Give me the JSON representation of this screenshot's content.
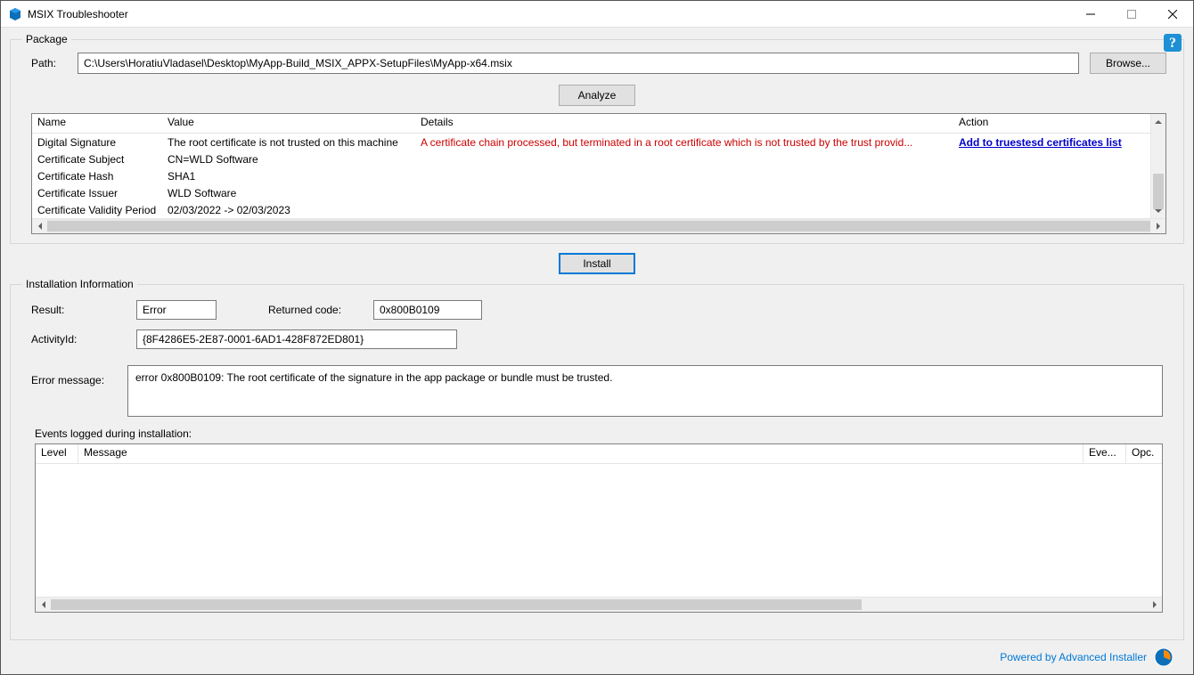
{
  "window": {
    "title": "MSIX Troubleshooter",
    "controls": {
      "minimize": "Minimize",
      "maximize": "Maximize",
      "close": "Close"
    }
  },
  "package": {
    "legend": "Package",
    "path_label": "Path:",
    "path_value": "C:\\Users\\HoratiuVladasel\\Desktop\\MyApp-Build_MSIX_APPX-SetupFiles\\MyApp-x64.msix",
    "browse_label": "Browse...",
    "analyze_label": "Analyze",
    "columns": {
      "name": "Name",
      "value": "Value",
      "details": "Details",
      "action": "Action"
    },
    "rows": [
      {
        "name": "Digital Signature",
        "value": "The root certificate is not trusted on this machine",
        "details": "A certificate chain processed, but terminated in a root certificate which is not trusted by the trust provid...",
        "action": "Add to truestesd certificates list "
      },
      {
        "name": "Certificate Subject",
        "value": "CN=WLD Software",
        "details": "",
        "action": ""
      },
      {
        "name": "Certificate Hash",
        "value": "SHA1",
        "details": "",
        "action": ""
      },
      {
        "name": "Certificate Issuer",
        "value": "WLD Software",
        "details": "",
        "action": ""
      },
      {
        "name": "Certificate Validity Period",
        "value": "02/03/2022 -> 02/03/2023",
        "details": "",
        "action": ""
      }
    ]
  },
  "install_button": "Install",
  "installation": {
    "legend": "Installation Information",
    "result_label": "Result:",
    "result_value": "Error",
    "returned_code_label": "Returned code:",
    "returned_code_value": "0x800B0109",
    "activity_label": "ActivityId:",
    "activity_value": "{8F4286E5-2E87-0001-6AD1-428F872ED801}",
    "error_label": "Error message:",
    "error_value": "error 0x800B0109: The root certificate of the signature in the app package or bundle must be trusted.",
    "events_label": "Events logged during installation:",
    "events_columns": {
      "level": "Level",
      "message": "Message",
      "eve": "Eve...",
      "opc": "Opc."
    }
  },
  "footer": {
    "powered_by": "Powered by Advanced Installer"
  }
}
